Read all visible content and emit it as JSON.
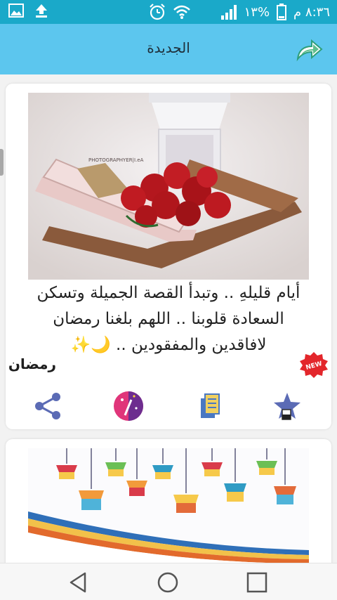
{
  "status_bar": {
    "time": "٨:٣٦ م",
    "battery": "%١٣",
    "left_icons": [
      "image-icon",
      "upload-icon"
    ],
    "right_icons": [
      "alarm-icon",
      "wifi-icon",
      "data-icon",
      "signal-icon",
      "battery-icon"
    ]
  },
  "app_bar": {
    "title": "الجديدة",
    "share_icon": "share-arrow-icon"
  },
  "cards": [
    {
      "image": "quran-stand-with-roses",
      "image_watermark": "PHOTOGRAPHYER|I.eA",
      "caption_lines": [
        "أيام قليلهِ .. وتبدأ القصة الجميلة وتسكن",
        "السعادة قلوبنا .. اللهم بلغنا رمضان",
        "لافاقدين والمفقودين .. 🌙✨"
      ],
      "category": "رمضان",
      "badge": "NEW",
      "actions": [
        "share-icon",
        "magic-wand-icon",
        "copy-icon",
        "favorite-star-icon"
      ]
    },
    {
      "image": "hanging-lanterns"
    }
  ],
  "nav_bar": {
    "buttons": [
      "back",
      "home",
      "recent-apps"
    ]
  },
  "colors": {
    "status_bar": "#1aa9c9",
    "app_bar": "#5cc6ee",
    "accent_green": "#5fbf8f",
    "share_purple": "#5b6bb5"
  }
}
